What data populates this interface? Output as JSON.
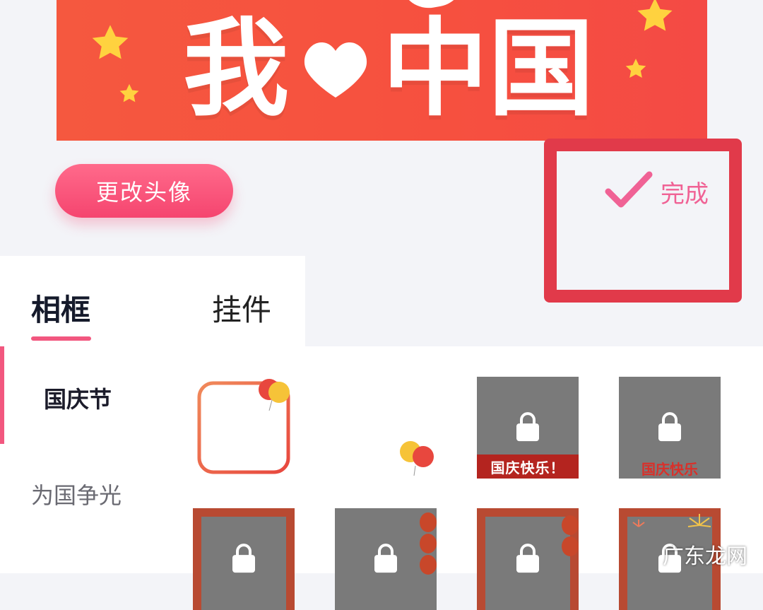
{
  "banner": {
    "word_left": "我",
    "word_right": "中国",
    "heart": "heart-icon",
    "colors": {
      "bg": "#f5583f",
      "text": "#ffffff",
      "star": "#ffd23f"
    }
  },
  "actions": {
    "change_avatar": "更改头像",
    "done": "完成"
  },
  "tabs": [
    {
      "label": "相框",
      "active": true
    },
    {
      "label": "挂件",
      "active": false
    }
  ],
  "sidebar": {
    "items": [
      {
        "label": "国庆节",
        "active": true
      },
      {
        "label": "为国争光",
        "active": false
      }
    ]
  },
  "tiles": [
    {
      "id": "balloon-frame",
      "locked": false
    },
    {
      "id": "balloon-sticker",
      "locked": false
    },
    {
      "id": "national-day-frame-1",
      "locked": true,
      "ribbon": "国庆快乐！"
    },
    {
      "id": "national-day-frame-2",
      "locked": true,
      "ribbon": "国庆快乐"
    },
    {
      "id": "red-border-frame",
      "locked": true
    },
    {
      "id": "lantern-frame-1",
      "locked": true
    },
    {
      "id": "lantern-frame-2",
      "locked": true
    },
    {
      "id": "fireworks-frame",
      "locked": true
    }
  ],
  "watermark": "广东龙网",
  "theme": {
    "accent": "#f2577f",
    "highlight_box": "#e13a4a"
  }
}
